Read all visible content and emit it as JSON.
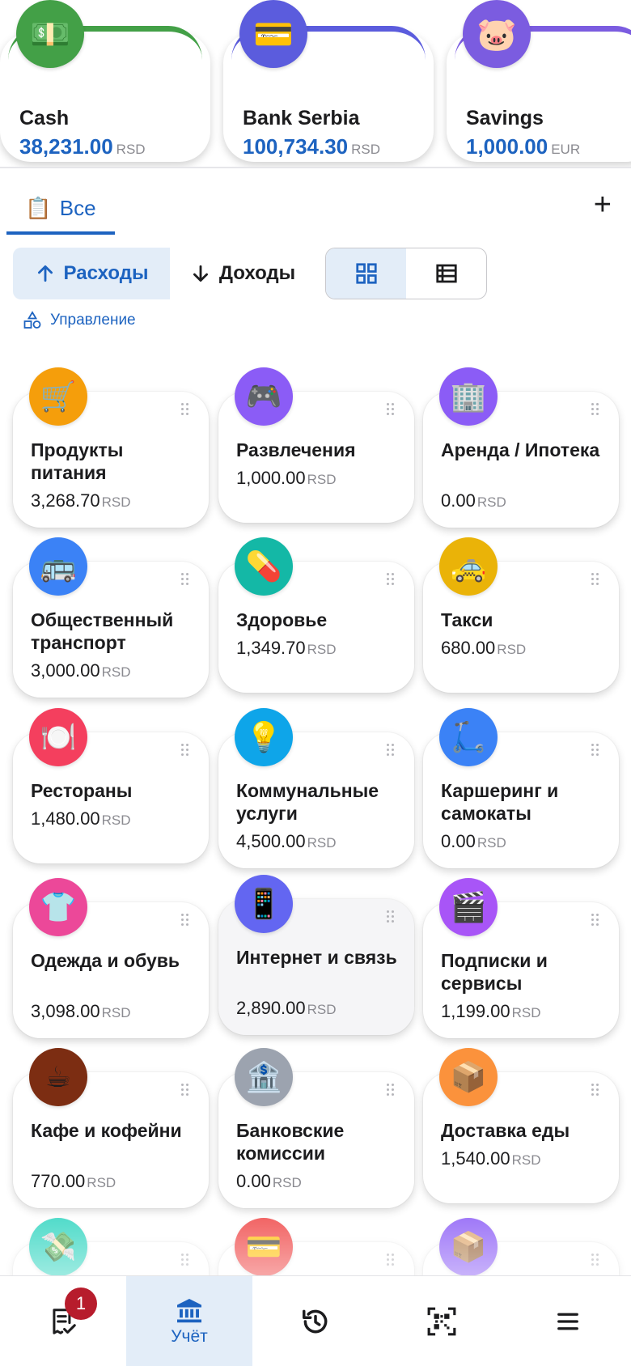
{
  "accounts": [
    {
      "name": "Cash",
      "amount": "38,231.00",
      "currency": "RSD",
      "icon": "banknote-icon",
      "emoji": "💵",
      "color": "#43a047"
    },
    {
      "name": "Bank Serbia",
      "amount": "100,734.30",
      "currency": "RSD",
      "icon": "credit-card-icon",
      "emoji": "💳",
      "color": "#5b5cdd"
    },
    {
      "name": "Savings",
      "amount": "1,000.00",
      "currency": "EUR",
      "icon": "piggy-bank-icon",
      "emoji": "🐷",
      "color": "#7b5ce0"
    }
  ],
  "tabs": {
    "all_emoji": "📋",
    "all_label": "Все",
    "add_label": "+"
  },
  "filters": {
    "expenses_label": "Расходы",
    "income_label": "Доходы"
  },
  "manage": {
    "label": "Управление"
  },
  "categories": [
    {
      "name": "Продукты питания",
      "amount": "3,268.70",
      "currency": "RSD",
      "icon": "cart-icon",
      "emoji": "🛒",
      "color": "#f59e0b"
    },
    {
      "name": "Развлечения",
      "amount": "1,000.00",
      "currency": "RSD",
      "icon": "gamepad-icon",
      "emoji": "🎮",
      "color": "#8b5cf6"
    },
    {
      "name": "Аренда / Ипотека",
      "amount": "0.00",
      "currency": "RSD",
      "icon": "building-icon",
      "emoji": "🏢",
      "color": "#8b5cf6"
    },
    {
      "name": "Общественный транспорт",
      "amount": "3,000.00",
      "currency": "RSD",
      "icon": "bus-icon",
      "emoji": "🚌",
      "color": "#3b82f6"
    },
    {
      "name": "Здоровье",
      "amount": "1,349.70",
      "currency": "RSD",
      "icon": "pill-icon",
      "emoji": "💊",
      "color": "#14b8a6"
    },
    {
      "name": "Такси",
      "amount": "680.00",
      "currency": "RSD",
      "icon": "taxi-icon",
      "emoji": "🚕",
      "color": "#eab308"
    },
    {
      "name": "Рестораны",
      "amount": "1,480.00",
      "currency": "RSD",
      "icon": "plate-icon",
      "emoji": "🍽️",
      "color": "#f43f5e"
    },
    {
      "name": "Коммунальные услуги",
      "amount": "4,500.00",
      "currency": "RSD",
      "icon": "lightbulb-icon",
      "emoji": "💡",
      "color": "#0ea5e9"
    },
    {
      "name": "Каршеринг и самокаты",
      "amount": "0.00",
      "currency": "RSD",
      "icon": "scooter-icon",
      "emoji": "🛴",
      "color": "#3b82f6"
    },
    {
      "name": "Одежда и обувь",
      "amount": "3,098.00",
      "currency": "RSD",
      "icon": "tshirt-icon",
      "emoji": "👕",
      "color": "#ec4899"
    },
    {
      "name": "Интернет и связь",
      "amount": "2,890.00",
      "currency": "RSD",
      "icon": "phone-icon",
      "emoji": "📱",
      "color": "#6366f1"
    },
    {
      "name": "Подписки и сервисы",
      "amount": "1,199.00",
      "currency": "RSD",
      "icon": "clapperboard-icon",
      "emoji": "🎬",
      "color": "#a855f7"
    },
    {
      "name": "Кафе и кофейни",
      "amount": "770.00",
      "currency": "RSD",
      "icon": "coffee-icon",
      "emoji": "☕",
      "color": "#7c2d12"
    },
    {
      "name": "Банковские комиссии",
      "amount": "0.00",
      "currency": "RSD",
      "icon": "bank-icon",
      "emoji": "🏦",
      "color": "#9ca3af"
    },
    {
      "name": "Доставка еды",
      "amount": "1,540.00",
      "currency": "RSD",
      "icon": "package-icon",
      "emoji": "📦",
      "color": "#fb923c"
    },
    {
      "name": "",
      "amount": "",
      "currency": "",
      "icon": "money-wings-icon",
      "emoji": "💸",
      "color": "#2dd4bf"
    },
    {
      "name": "",
      "amount": "",
      "currency": "",
      "icon": "credit-card-icon",
      "emoji": "💳",
      "color": "#ef4444"
    },
    {
      "name": "",
      "amount": "",
      "currency": "",
      "icon": "package-icon",
      "emoji": "📦",
      "color": "#8b5cf6"
    }
  ],
  "bottom_nav": {
    "badge_count": "1",
    "accounting_label": "Учёт"
  }
}
